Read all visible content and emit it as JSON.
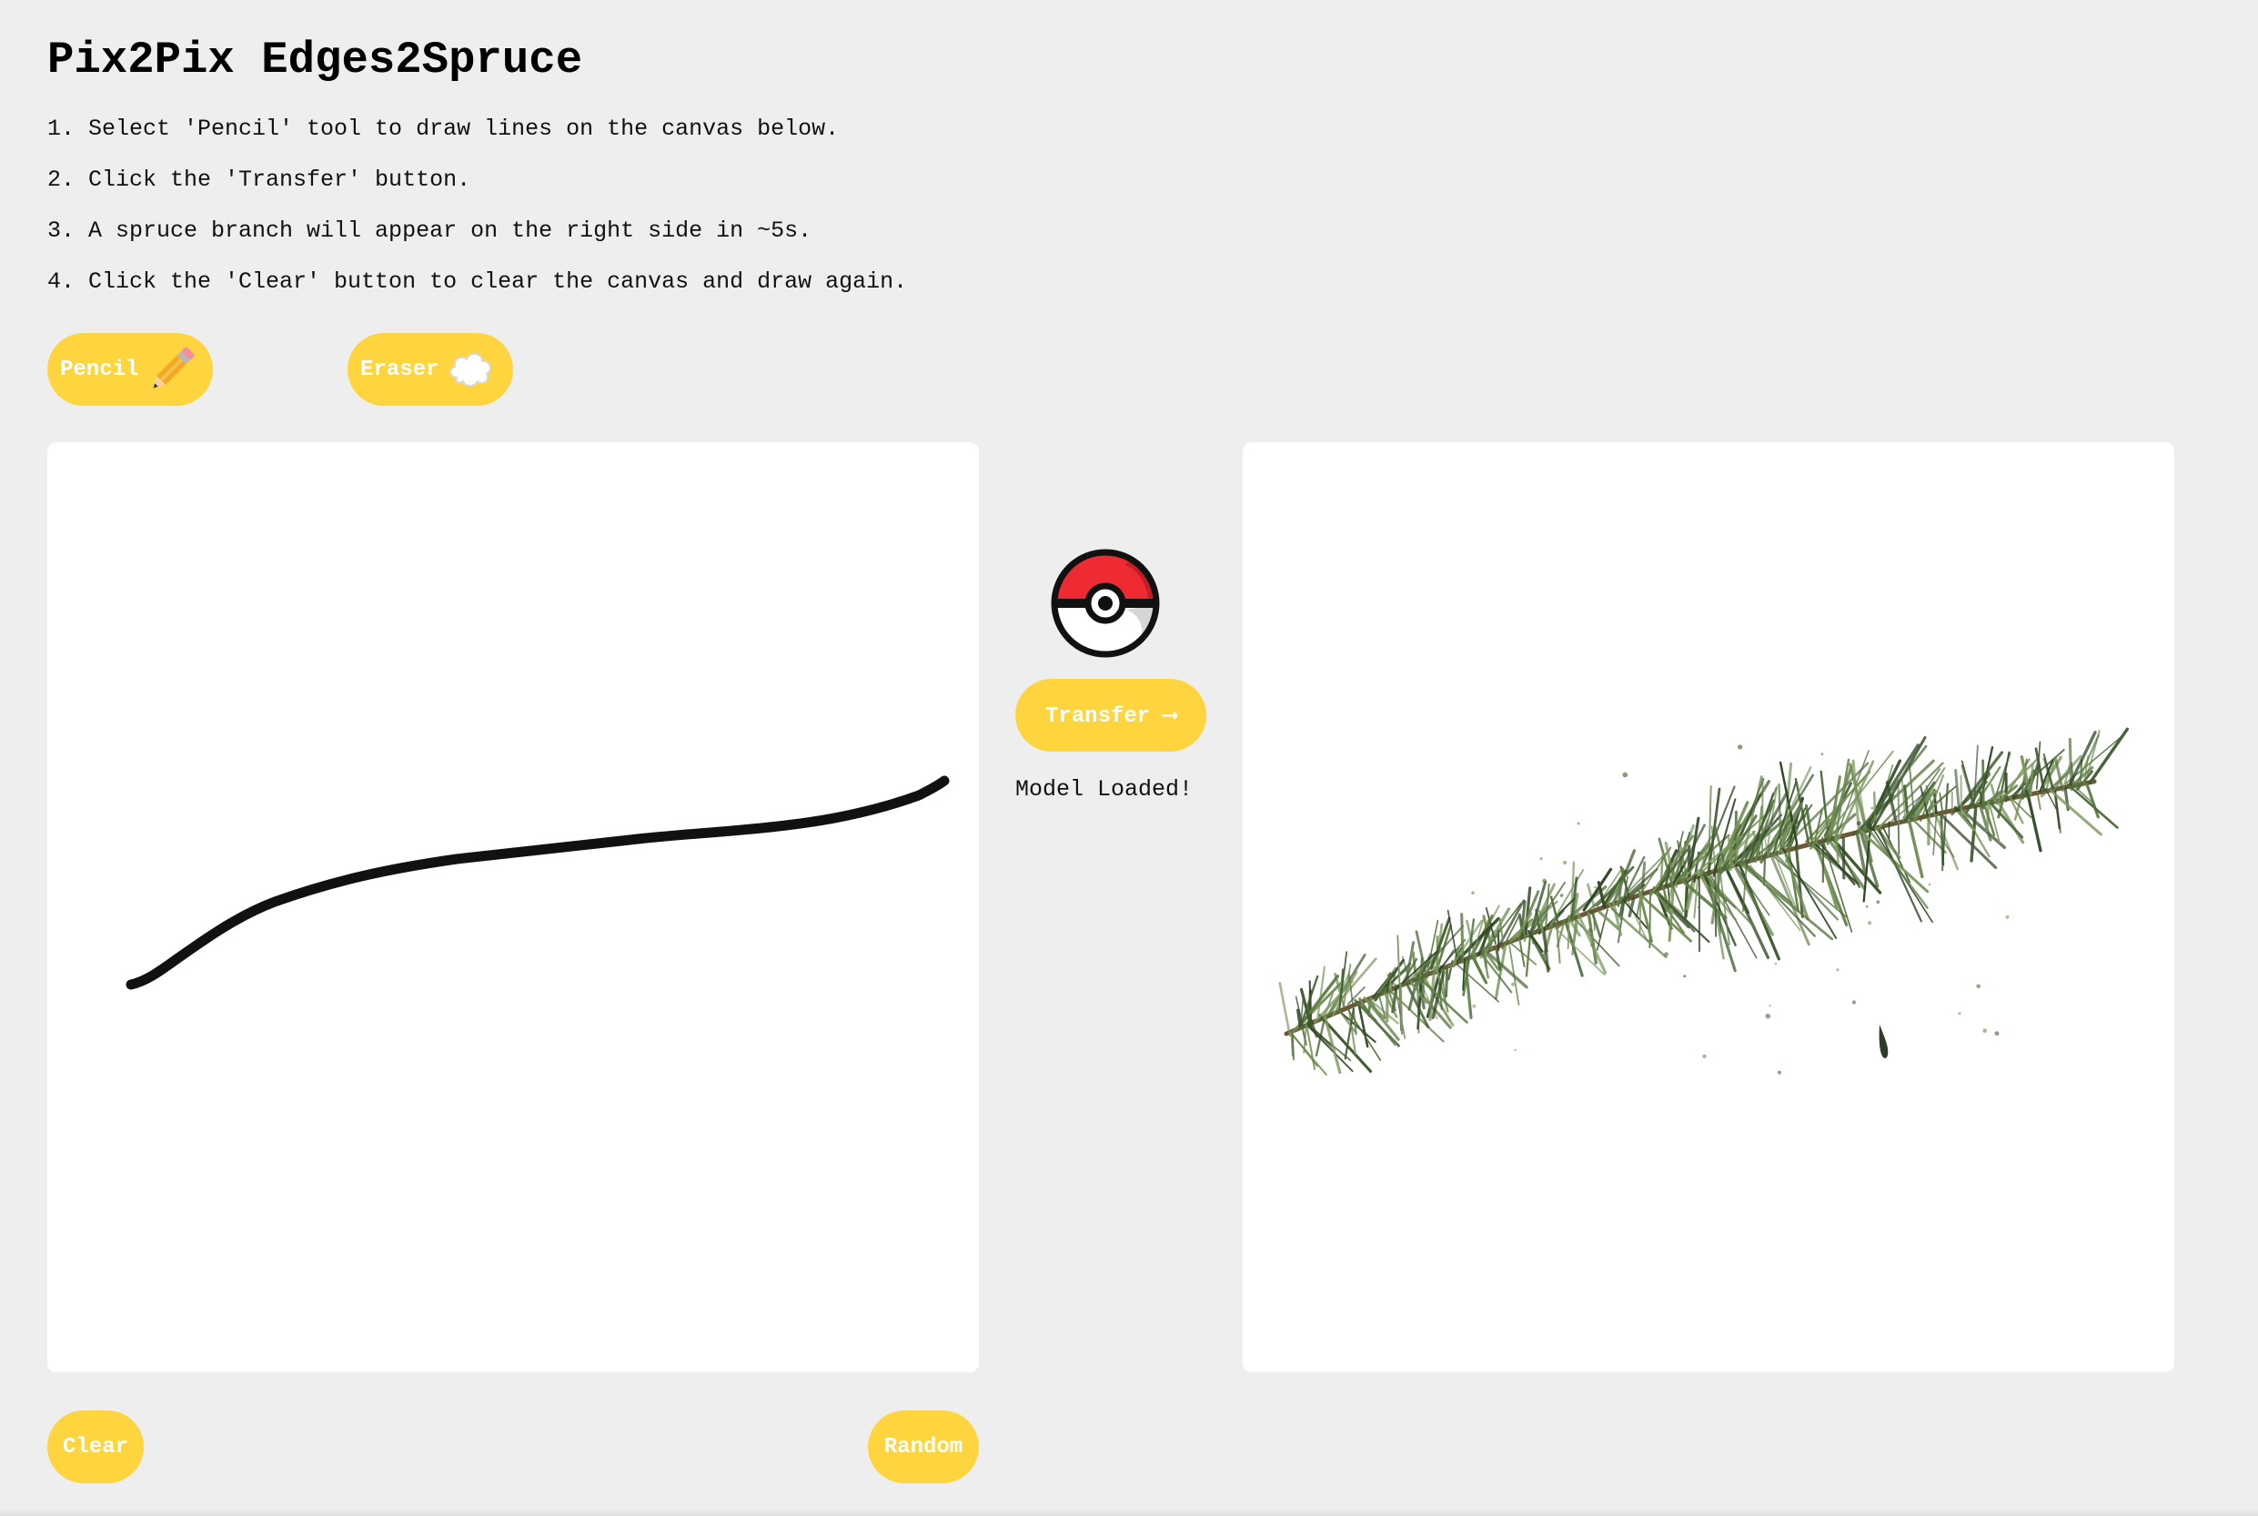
{
  "page": {
    "title": "Pix2Pix Edges2Spruce"
  },
  "instructions": [
    "1. Select 'Pencil' tool to draw lines on the canvas below.",
    "2. Click the 'Transfer' button.",
    "3. A spruce branch will appear on the right side in ~5s.",
    "4. Click the 'Clear' button to clear the canvas and draw again."
  ],
  "tools": {
    "pencil_label": "Pencil",
    "pencil_icon": "pencil-icon",
    "eraser_label": "Eraser",
    "eraser_icon": "eraser-cloud-icon"
  },
  "transfer": {
    "label": "Transfer ⟶",
    "icon": "pokeball-icon",
    "status": "Model Loaded!"
  },
  "actions": {
    "clear_label": "Clear",
    "random_label": "Random"
  },
  "colors": {
    "accent": "#ffd53f",
    "background": "#eeeeee",
    "canvas": "#ffffff",
    "stroke": "#111111",
    "spruce": "#4d6b3a",
    "pokeball_red": "#ee2a33"
  }
}
